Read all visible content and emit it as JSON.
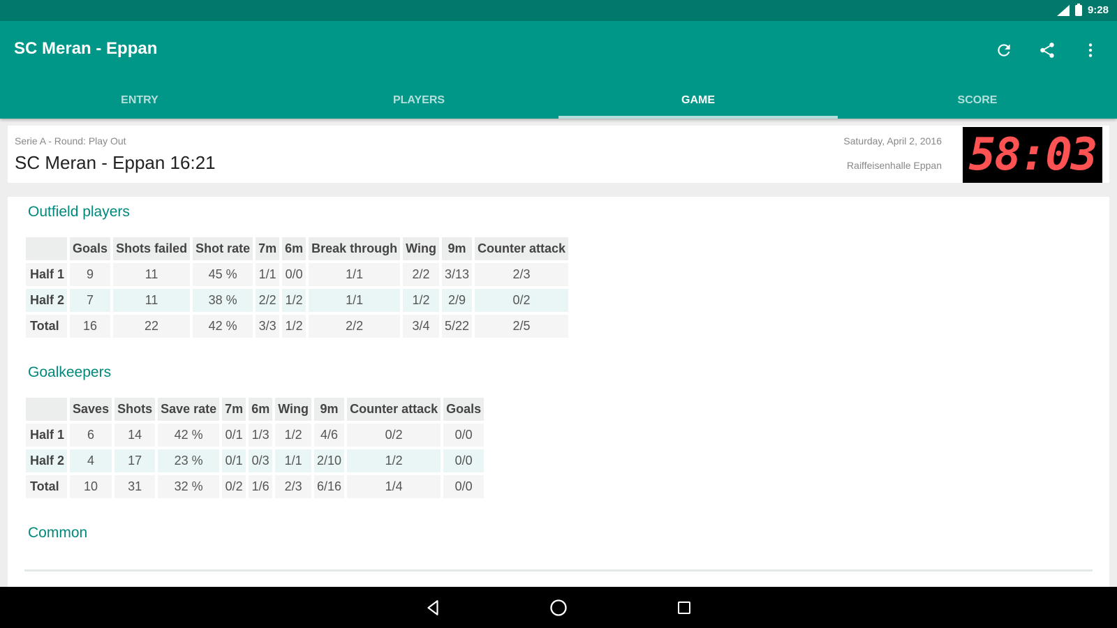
{
  "status_bar": {
    "time": "9:28"
  },
  "app_bar": {
    "title": "SC Meran - Eppan",
    "actions": [
      "refresh-icon",
      "share-icon",
      "more-vert-icon"
    ]
  },
  "tabs": [
    {
      "label": "ENTRY",
      "active": false
    },
    {
      "label": "PLAYERS",
      "active": false
    },
    {
      "label": "GAME",
      "active": true
    },
    {
      "label": "SCORE",
      "active": false
    }
  ],
  "game": {
    "league": "Serie A - Round: Play Out",
    "match": "SC Meran - Eppan 16:21",
    "date": "Saturday, April 2, 2016",
    "venue": "Raiffeisenhalle Eppan",
    "clock": "58:03"
  },
  "outfield": {
    "title": "Outfield players",
    "headers": [
      "",
      "Goals",
      "Shots failed",
      "Shot rate",
      "7m",
      "6m",
      "Break through",
      "Wing",
      "9m",
      "Counter attack"
    ],
    "rows": [
      [
        "Half 1",
        "9",
        "11",
        "45 %",
        "1/1",
        "0/0",
        "1/1",
        "2/2",
        "3/13",
        "2/3"
      ],
      [
        "Half 2",
        "7",
        "11",
        "38 %",
        "2/2",
        "1/2",
        "1/1",
        "1/2",
        "2/9",
        "0/2"
      ],
      [
        "Total",
        "16",
        "22",
        "42 %",
        "3/3",
        "1/2",
        "2/2",
        "3/4",
        "5/22",
        "2/5"
      ]
    ]
  },
  "goalkeepers": {
    "title": "Goalkeepers",
    "headers": [
      "",
      "Saves",
      "Shots",
      "Save rate",
      "7m",
      "6m",
      "Wing",
      "9m",
      "Counter attack",
      "Goals"
    ],
    "rows": [
      [
        "Half 1",
        "6",
        "14",
        "42 %",
        "0/1",
        "1/3",
        "1/2",
        "4/6",
        "0/2",
        "0/0"
      ],
      [
        "Half 2",
        "4",
        "17",
        "23 %",
        "0/1",
        "0/3",
        "1/1",
        "2/10",
        "1/2",
        "0/0"
      ],
      [
        "Total",
        "10",
        "31",
        "32 %",
        "0/2",
        "1/6",
        "2/3",
        "6/16",
        "1/4",
        "0/0"
      ]
    ]
  },
  "common": {
    "title": "Common"
  },
  "nav_bar": [
    "back-icon",
    "home-icon",
    "recents-icon"
  ]
}
